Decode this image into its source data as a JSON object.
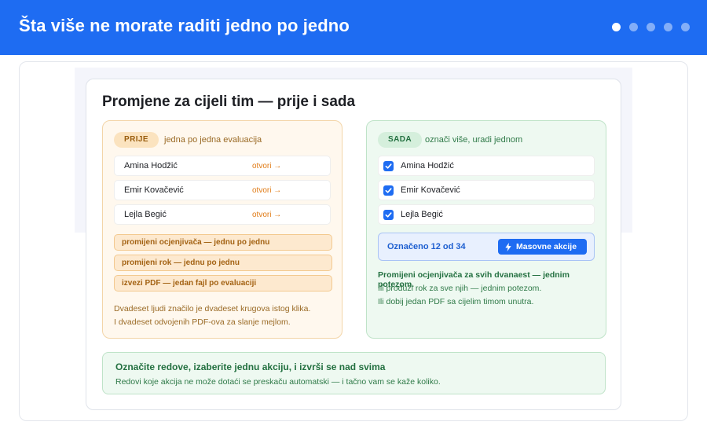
{
  "header": {
    "title": "Šta više ne morate raditi jedno po jedno",
    "slides": 5,
    "active_slide": 0
  },
  "card": {
    "title": "Promjene za cijeli tim — prije i sada"
  },
  "before": {
    "pill": "PRIJE",
    "caption": "jedna po jedna evaluacija",
    "rows": [
      {
        "name": "Amina Hodžić",
        "link": "otvori →"
      },
      {
        "name": "Emir Kovačević",
        "link": "otvori →"
      },
      {
        "name": "Lejla Begić",
        "link": "otvori →"
      }
    ],
    "chips": [
      "promijeni ocjenjivača — jednu po jednu",
      "promijeni rok — jednu po jednu",
      "izvezi PDF — jedan fajl po evaluaciji"
    ],
    "note": [
      "Dvadeset ljudi značilo je dvadeset krugova istog klika.",
      "I dvadeset odvojenih PDF-ova za slanje mejlom."
    ]
  },
  "after": {
    "pill": "SADA",
    "caption": "označi više, uradi jednom",
    "rows": [
      {
        "name": "Amina Hodžić",
        "checked": true
      },
      {
        "name": "Emir Kovačević",
        "checked": true
      },
      {
        "name": "Lejla Begić",
        "checked": true
      }
    ],
    "selection": {
      "count_label": "Označeno 12 od 34",
      "button_label": "Masovne akcije"
    },
    "strong": "Promijeni ocjenjivača za svih dvanaest — jednim potezom.",
    "lines": [
      "Ili produži rok za sve njih — jednim potezom.",
      "Ili dobij jedan PDF sa cijelim timom unutra."
    ]
  },
  "footer": {
    "title": "Označite redove, izaberite jednu akciju, i izvrši se nad svima",
    "subtitle": "Redovi koje akcija ne može dotaći se preskaču automatski — i tačno vam se kaže koliko."
  },
  "colors": {
    "brand_blue": "#1e6cf2",
    "before_accent": "#e07b16",
    "after_accent": "#237040"
  }
}
